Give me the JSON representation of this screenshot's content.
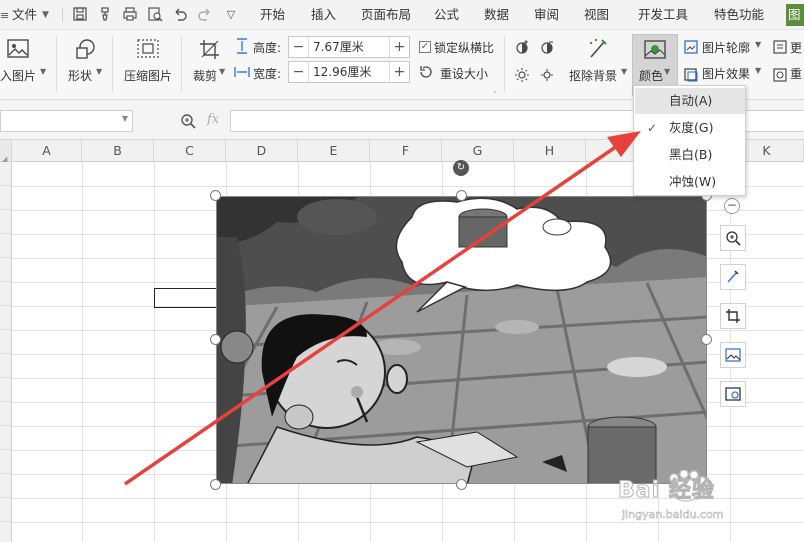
{
  "menubar": {
    "file_menu": "文件",
    "tabs": [
      "开始",
      "插入",
      "页面布局",
      "公式",
      "数据",
      "审阅",
      "视图",
      "开发工具",
      "特色功能"
    ],
    "cut_tab": "图"
  },
  "ribbon": {
    "insert_picture": "入图片",
    "shape": "形状",
    "compress": "压缩图片",
    "crop": "裁剪",
    "height_label": "高度:",
    "height_value": "7.67厘米",
    "width_label": "宽度:",
    "width_value": "12.96厘米",
    "lock_ratio": "锁定纵横比",
    "reset_size": "重设大小",
    "remove_bg": "抠除背景",
    "color": "颜色",
    "outline": "图片轮廓",
    "effect": "图片效果",
    "more_1": "更",
    "more_2": "重"
  },
  "formula_bar": {
    "fx": "fx"
  },
  "columns": [
    "A",
    "B",
    "C",
    "D",
    "E",
    "F",
    "G",
    "H",
    "I",
    "K"
  ],
  "color_menu": {
    "items": [
      "自动(A)",
      "灰度(G)",
      "黑白(B)",
      "冲蚀(W)"
    ],
    "selected": "自动(A)",
    "checked": "灰度(G)"
  },
  "watermark": {
    "brand": "Bai 经验",
    "url": "jingyan.baidu.com"
  },
  "colors": {
    "arrow": "#e8413b",
    "menu_highlight": "#d4d4d4",
    "checkbox": "#2a7a2a"
  }
}
